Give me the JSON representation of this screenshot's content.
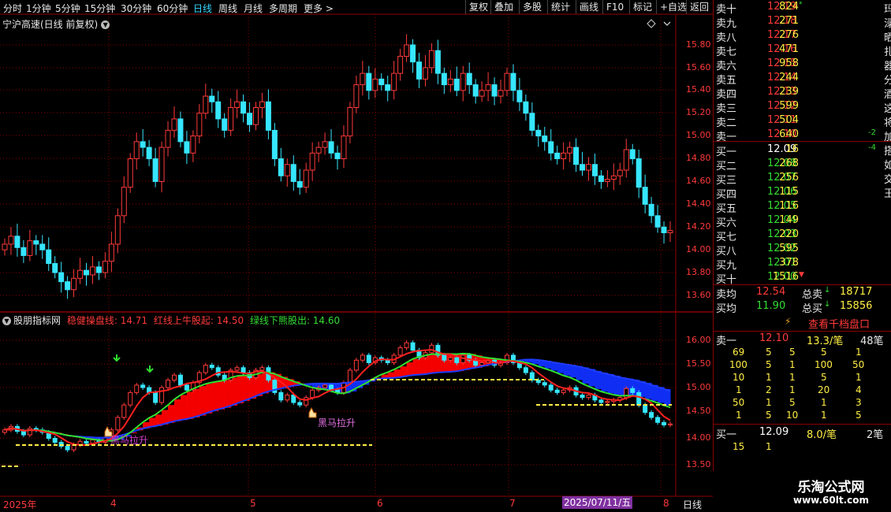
{
  "toolbar": {
    "periods": [
      "分时",
      "1分钟",
      "5分钟",
      "15分钟",
      "30分钟",
      "60分钟",
      "日线",
      "周线",
      "月线",
      "多周期",
      "更多 >"
    ],
    "active_period": "日线",
    "right_tabs": [
      "复权",
      "叠加",
      "多股",
      "统计",
      "画线",
      "F10",
      "标记",
      "+自选",
      "返回"
    ]
  },
  "stock_title": "宁沪高速(日线 前复权)",
  "indicator": {
    "name": "股朋指标网",
    "line1_label": "稳健操盘线: 14.71",
    "line2_label": "红线上牛股起: 14.50",
    "line3_label": "绿线下熊股出: 14.60",
    "annotations": [
      "黑马拉升",
      "黑马拉升"
    ]
  },
  "time_axis": {
    "labels": [
      "2025年",
      "4",
      "5",
      "6",
      "7",
      "8"
    ],
    "cursor_date": "2025/07/11/五",
    "period_label": "日线"
  },
  "price_axis": [
    "15.80",
    "15.60",
    "15.40",
    "15.20",
    "15.00",
    "14.80",
    "14.60",
    "14.40",
    "14.20",
    "14.00",
    "13.80",
    "13.60"
  ],
  "ind_axis": [
    "16.00",
    "15.50",
    "15.00",
    "14.50",
    "14.00",
    "13.50"
  ],
  "order_book": {
    "sells": [
      {
        "label": "卖十",
        "price": "12.19",
        "vol": "824",
        "chg": "",
        "mark": "*"
      },
      {
        "label": "卖九",
        "price": "12.18",
        "vol": "271",
        "chg": "",
        "mark": ""
      },
      {
        "label": "卖八",
        "price": "12.17",
        "vol": "276",
        "chg": "",
        "mark": ""
      },
      {
        "label": "卖七",
        "price": "12.16",
        "vol": "471",
        "chg": "",
        "mark": ""
      },
      {
        "label": "卖六",
        "price": "12.15",
        "vol": "958",
        "chg": "",
        "mark": ""
      },
      {
        "label": "卖五",
        "price": "12.14",
        "vol": "244",
        "chg": "",
        "mark": ""
      },
      {
        "label": "卖四",
        "price": "12.13",
        "vol": "239",
        "chg": "",
        "mark": ""
      },
      {
        "label": "卖三",
        "price": "12.12",
        "vol": "599",
        "chg": "",
        "mark": ""
      },
      {
        "label": "卖二",
        "price": "12.11",
        "vol": "504",
        "chg": "",
        "mark": ""
      },
      {
        "label": "卖一",
        "price": "12.10",
        "vol": "640",
        "chg": "-2",
        "mark": ""
      }
    ],
    "buys": [
      {
        "label": "买一",
        "price": "12.09",
        "vol": "16",
        "chg": "-4",
        "mark": ""
      },
      {
        "label": "买二",
        "price": "12.08",
        "vol": "268",
        "chg": "",
        "mark": ""
      },
      {
        "label": "买三",
        "price": "12.07",
        "vol": "256",
        "chg": "",
        "mark": ""
      },
      {
        "label": "买四",
        "price": "12.06",
        "vol": "115",
        "chg": "",
        "mark": ""
      },
      {
        "label": "买五",
        "price": "12.05",
        "vol": "116",
        "chg": "",
        "mark": ""
      },
      {
        "label": "买六",
        "price": "12.04",
        "vol": "149",
        "chg": "",
        "mark": ""
      },
      {
        "label": "买七",
        "price": "12.03",
        "vol": "220",
        "chg": "",
        "mark": ""
      },
      {
        "label": "买八",
        "price": "12.02",
        "vol": "595",
        "chg": "",
        "mark": ""
      },
      {
        "label": "买九",
        "price": "12.01",
        "vol": "378",
        "chg": "",
        "mark": ""
      },
      {
        "label": "买十",
        "price": "12.00",
        "vol": "1516",
        "chg": "",
        "mark": "▼"
      }
    ],
    "avg_sell_label": "卖均",
    "avg_sell_price": "12.54",
    "total_sell_label": "总卖",
    "total_sell": "18717",
    "avg_buy_label": "买均",
    "avg_buy_price": "11.90",
    "total_buy_label": "总买",
    "total_buy": "15856"
  },
  "depth_panel": {
    "button": "查看千档盘口",
    "sell1_label": "卖一",
    "sell1_price": "12.10",
    "sell1_avg": "13.3/笔",
    "sell1_count": "48笔",
    "sell_grid": [
      [
        "69",
        "5",
        "5",
        "5",
        "1"
      ],
      [
        "100",
        "5",
        "1",
        "100",
        "50"
      ],
      [
        "10",
        "1",
        "1",
        "5",
        "1"
      ],
      [
        "1",
        "2",
        "1",
        "20",
        "4"
      ],
      [
        "50",
        "1",
        "5",
        "1",
        "3"
      ],
      [
        "1",
        "5",
        "10",
        "1",
        "5"
      ]
    ],
    "buy1_label": "买一",
    "buy1_price": "12.09",
    "buy1_avg": "8.0/笔",
    "buy1_count": "2笔",
    "buy_grid": [
      [
        "15",
        "1"
      ]
    ]
  },
  "right_edge_chars": [
    "玛",
    "渌",
    "晒",
    "扎",
    "器",
    "分",
    "酒",
    "这",
    "将",
    "加",
    "搭",
    "如",
    "交",
    "王"
  ],
  "watermark": {
    "line1": "乐淘公式网",
    "line2": "www.60lt.com"
  },
  "colors": {
    "up": "#ff3a3a",
    "down": "#36e6ff",
    "ma_red": "#ff2020",
    "ma_green": "#30e030",
    "ma_blue": "#1e3cff",
    "yellow": "#ffee44",
    "grid": "#8b0000",
    "white_price": "#ffffff",
    "green_price": "#33dd33"
  }
}
